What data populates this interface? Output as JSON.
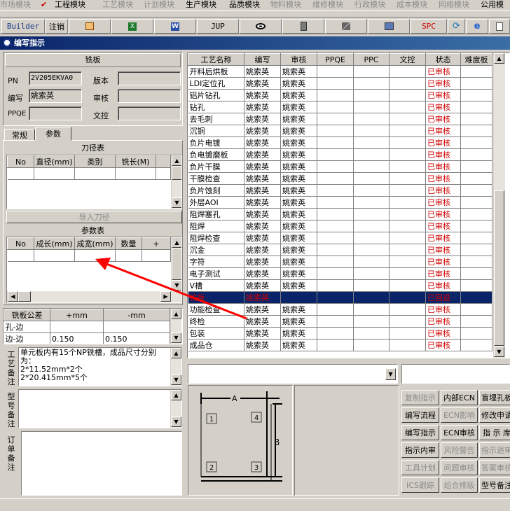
{
  "menubar": {
    "items": [
      {
        "label": "市场模块",
        "enabled": false
      },
      {
        "label": "工程模块",
        "enabled": true,
        "checked": true
      },
      {
        "label": "工艺模块",
        "enabled": false
      },
      {
        "label": "计划模块",
        "enabled": false
      },
      {
        "label": "生产模块",
        "enabled": true
      },
      {
        "label": "品质模块",
        "enabled": true
      },
      {
        "label": "物料模块",
        "enabled": false
      },
      {
        "label": "维修模块",
        "enabled": false
      },
      {
        "label": "行政模块",
        "enabled": false
      },
      {
        "label": "成本模块",
        "enabled": false
      },
      {
        "label": "网络模块",
        "enabled": false
      },
      {
        "label": "公用模",
        "enabled": true
      }
    ]
  },
  "toolbar": {
    "builder": "Builder",
    "logout": "注销",
    "jup": "JUP",
    "spc": "SPC",
    "icons": [
      "box-icon",
      "excel-icon",
      "word-icon",
      "jup-button",
      "eye-icon",
      "database-icon",
      "network-icon",
      "computer-icon",
      "spc-button",
      "refresh-icon",
      "ie-icon",
      "page-icon"
    ]
  },
  "window": {
    "title": "编写指示"
  },
  "info": {
    "header": "铣板",
    "pn_label": "PN",
    "pn_value": "2V205EKVA0",
    "version_label": "版本",
    "version_value": "",
    "writer_label": "编写",
    "writer_value": "姚索英",
    "review_label": "审核",
    "review_value": "",
    "ppqe_label": "PPQE",
    "ppqe_value": "",
    "doc_label": "文控",
    "doc_value": ""
  },
  "tabs": [
    "常规",
    "参数"
  ],
  "cutter": {
    "title": "刀径表",
    "columns": [
      "No",
      "直径(mm)",
      "类别",
      "铣长(M)"
    ],
    "import_label": "导入刀径"
  },
  "params": {
    "title": "参数表",
    "columns": [
      "No",
      "成长(mm)",
      "成宽(mm)",
      "数量",
      "+"
    ]
  },
  "tolerance": {
    "columns": [
      "铣板公差",
      "+mm",
      "-mm"
    ],
    "rows": [
      [
        "孔-边",
        "",
        ""
      ],
      [
        "边-边",
        "0.150",
        "0.150"
      ]
    ]
  },
  "notes": {
    "process_label": "工艺备注",
    "process_text": "单元板内有15个NP铣槽，成品尺寸分别为：\n2*11.52mm*2个\n2*20.415mm*5个",
    "model_label": "型号备注",
    "order_label": "订单备注"
  },
  "process_table": {
    "columns": [
      "工艺名称",
      "编写",
      "审核",
      "PPQE",
      "PPC",
      "文控",
      "状态",
      "难度板"
    ],
    "rows": [
      [
        "开料后烘板",
        "姚索英",
        "姚索英",
        "",
        "",
        "",
        "已审核",
        ""
      ],
      [
        "LDI定位孔",
        "姚索英",
        "姚索英",
        "",
        "",
        "",
        "已审核",
        ""
      ],
      [
        "铝片钻孔",
        "姚索英",
        "姚索英",
        "",
        "",
        "",
        "已审核",
        ""
      ],
      [
        "钻孔",
        "姚索英",
        "姚索英",
        "",
        "",
        "",
        "已审核",
        ""
      ],
      [
        "去毛刺",
        "姚索英",
        "姚索英",
        "",
        "",
        "",
        "已审核",
        ""
      ],
      [
        "沉铜",
        "姚索英",
        "姚索英",
        "",
        "",
        "",
        "已审核",
        ""
      ],
      [
        "负片电镀",
        "姚索英",
        "姚索英",
        "",
        "",
        "",
        "已审核",
        ""
      ],
      [
        "负电镀磨板",
        "姚索英",
        "姚索英",
        "",
        "",
        "",
        "已审核",
        ""
      ],
      [
        "负片干膜",
        "姚索英",
        "姚索英",
        "",
        "",
        "",
        "已审核",
        ""
      ],
      [
        "干膜检查",
        "姚索英",
        "姚索英",
        "",
        "",
        "",
        "已审核",
        ""
      ],
      [
        "负片蚀刻",
        "姚索英",
        "姚索英",
        "",
        "",
        "",
        "已审核",
        ""
      ],
      [
        "外层AOI",
        "姚索英",
        "姚索英",
        "",
        "",
        "",
        "已审核",
        ""
      ],
      [
        "阻焊塞孔",
        "姚索英",
        "姚索英",
        "",
        "",
        "",
        "已审核",
        ""
      ],
      [
        "阻焊",
        "姚索英",
        "姚索英",
        "",
        "",
        "",
        "已审核",
        ""
      ],
      [
        "阻焊检查",
        "姚索英",
        "姚索英",
        "",
        "",
        "",
        "已审核",
        ""
      ],
      [
        "沉金",
        "姚索英",
        "姚索英",
        "",
        "",
        "",
        "已审核",
        ""
      ],
      [
        "字符",
        "姚索英",
        "姚索英",
        "",
        "",
        "",
        "已审核",
        ""
      ],
      [
        "电子测试",
        "姚索英",
        "姚索英",
        "",
        "",
        "",
        "已审核",
        ""
      ],
      [
        "V槽",
        "姚索英",
        "姚索英",
        "",
        "",
        "",
        "已审核",
        ""
      ],
      [
        "铣板",
        "姚索英",
        "",
        "",
        "",
        "",
        "已回退",
        ""
      ],
      [
        "功能检查",
        "姚索英",
        "姚索英",
        "",
        "",
        "",
        "已审核",
        ""
      ],
      [
        "终检",
        "姚索英",
        "姚索英",
        "",
        "",
        "",
        "已审核",
        ""
      ],
      [
        "包装",
        "姚索英",
        "姚索英",
        "",
        "",
        "",
        "已审核",
        ""
      ],
      [
        "成品仓",
        "姚索英",
        "姚索英",
        "",
        "",
        "",
        "已审核",
        ""
      ]
    ],
    "selected_index": 19
  },
  "diagram": {
    "label_a": "A",
    "label_b": "B",
    "corners": [
      "1",
      "4",
      "2",
      "3"
    ]
  },
  "buttons": [
    {
      "label": "复制指示",
      "enabled": false
    },
    {
      "label": "内部ECN",
      "enabled": true
    },
    {
      "label": "盲埋孔板",
      "enabled": true
    },
    {
      "label": "编写流程",
      "enabled": true
    },
    {
      "label": "ECN影响",
      "enabled": false
    },
    {
      "label": "修改申请",
      "enabled": true
    },
    {
      "label": "编写指示",
      "enabled": true
    },
    {
      "label": "ECN审核",
      "enabled": true
    },
    {
      "label": "指 示 库",
      "enabled": true
    },
    {
      "label": "指示内审",
      "enabled": true
    },
    {
      "label": "风险警告",
      "enabled": false
    },
    {
      "label": "指示退审",
      "enabled": false
    },
    {
      "label": "工具计划",
      "enabled": false
    },
    {
      "label": "问题审核",
      "enabled": false
    },
    {
      "label": "答案审核",
      "enabled": false
    },
    {
      "label": "ICS跟踪",
      "enabled": false
    },
    {
      "label": "组合排版",
      "enabled": false
    },
    {
      "label": "型号备注",
      "enabled": true
    }
  ],
  "colors": {
    "title_bar": "#0a246a",
    "selected_row": "#0a246a",
    "status_text": "#d00000",
    "annotation_arrow": "#ff0000"
  }
}
